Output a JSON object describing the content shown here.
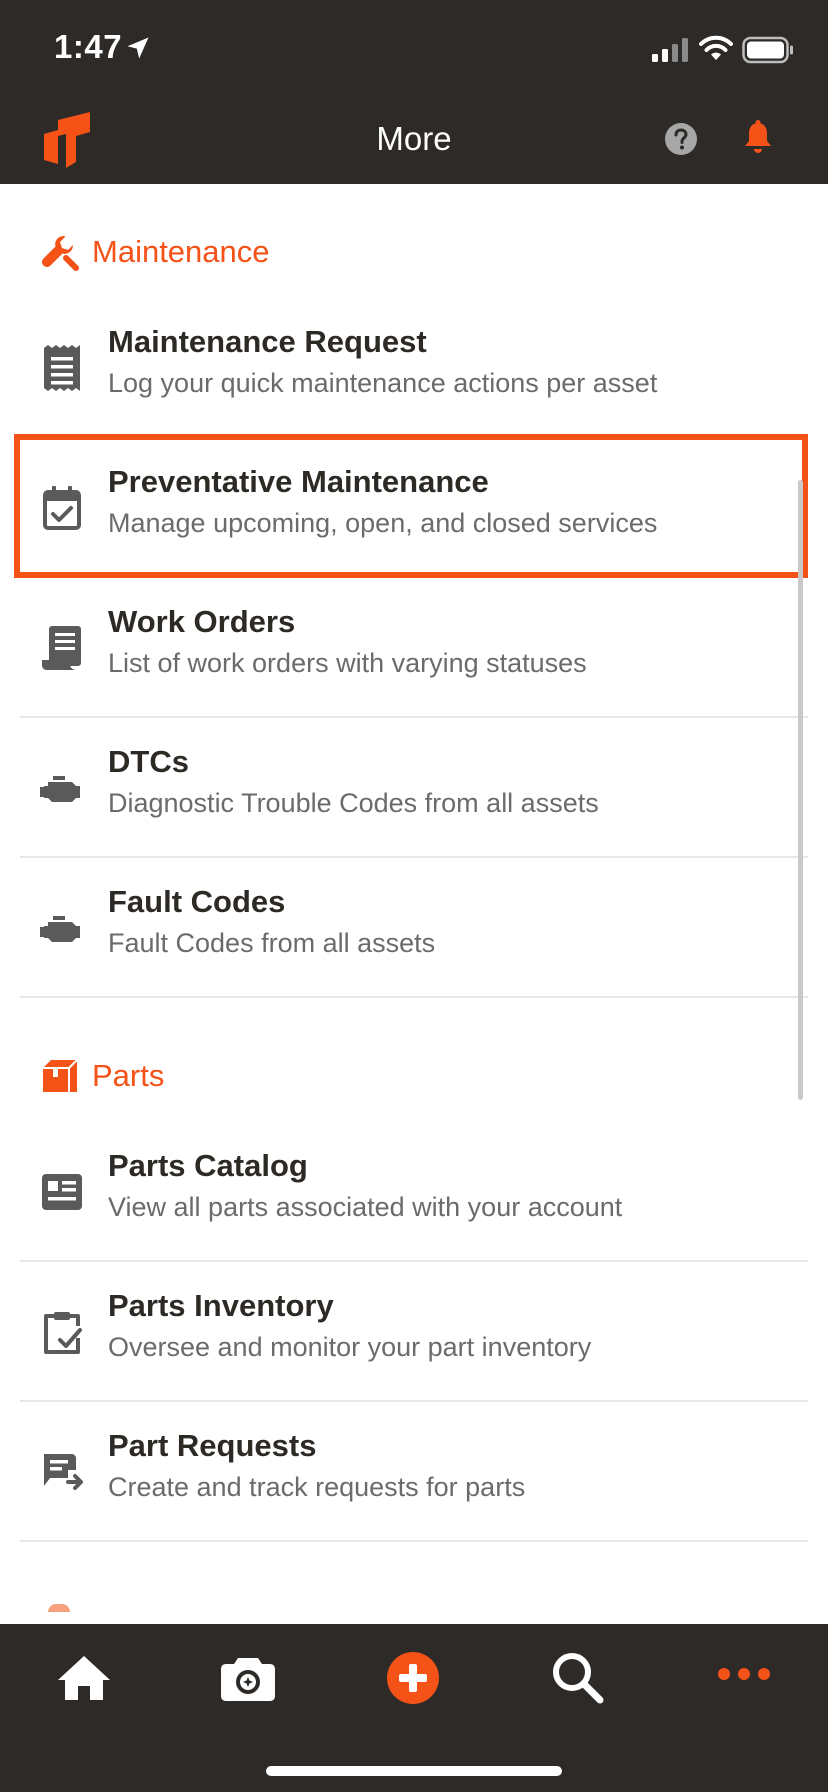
{
  "status_bar": {
    "time": "1:47"
  },
  "header": {
    "title": "More"
  },
  "sections": [
    {
      "label": "Maintenance",
      "items": [
        {
          "title": "Maintenance Request",
          "subtitle": "Log your quick maintenance actions per asset",
          "icon": "receipt-icon"
        },
        {
          "title": "Preventative Maintenance",
          "subtitle": "Manage upcoming, open, and closed services",
          "icon": "calendar-check-icon"
        },
        {
          "title": "Work Orders",
          "subtitle": "List of work orders with varying statuses",
          "icon": "work-order-icon"
        },
        {
          "title": "DTCs",
          "subtitle": "Diagnostic Trouble Codes from all assets",
          "icon": "engine-icon"
        },
        {
          "title": "Fault Codes",
          "subtitle": "Fault Codes from all assets",
          "icon": "engine-icon"
        }
      ]
    },
    {
      "label": "Parts",
      "items": [
        {
          "title": "Parts Catalog",
          "subtitle": "View all parts associated with your account",
          "icon": "catalog-icon"
        },
        {
          "title": "Parts Inventory",
          "subtitle": "Oversee and monitor your part inventory",
          "icon": "clipboard-check-icon"
        },
        {
          "title": "Part Requests",
          "subtitle": "Create and track requests for parts",
          "icon": "request-icon"
        }
      ]
    }
  ],
  "highlighted_item": "Preventative Maintenance",
  "tab_bar": {
    "tabs": [
      {
        "icon": "home-icon"
      },
      {
        "icon": "camera-icon"
      },
      {
        "icon": "add-icon"
      },
      {
        "icon": "search-icon"
      },
      {
        "icon": "more-icon",
        "active": true
      }
    ]
  },
  "colors": {
    "accent": "#f55217",
    "bar_background": "#2d2a27",
    "text_primary": "#2d2a26",
    "text_secondary": "#6b6b6b",
    "divider": "#e7e7e7"
  }
}
